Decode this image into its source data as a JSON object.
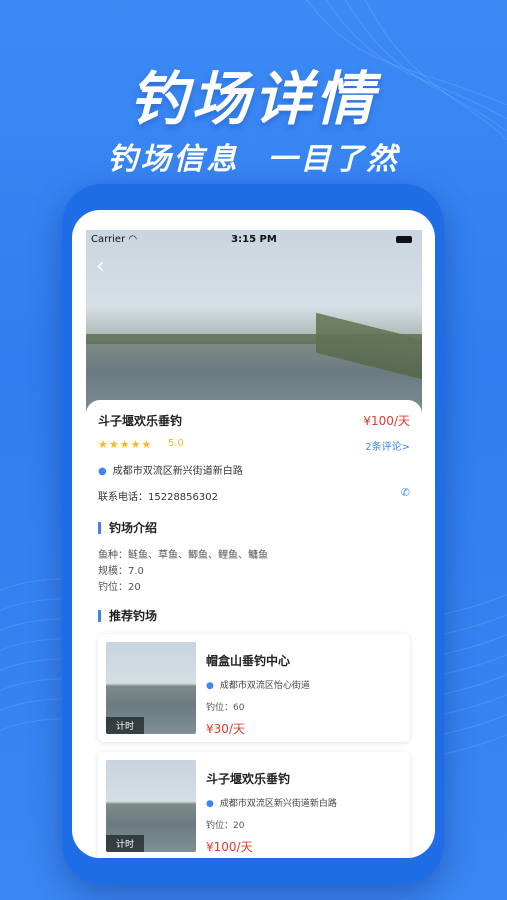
{
  "promo": {
    "headline": "钓场详情",
    "subline_left": "钓场信息",
    "subline_right": "一目了然"
  },
  "status_bar": {
    "carrier": "Carrier",
    "time": "3:15 PM"
  },
  "spot": {
    "name": "斗子堰欢乐垂钓",
    "price": "¥100/天",
    "stars": "★★★★★",
    "rating": "5.0",
    "comments_link": "2条评论>",
    "address": "成都市双流区新兴街道新白路",
    "phone_label": "联系电话：",
    "phone": "15228856302"
  },
  "intro": {
    "title": "钓场介绍",
    "fish": "鱼种：鲢鱼、草鱼、鲫鱼、鲤鱼、鳙鱼",
    "scale": "规模：7.0",
    "seats": "钓位：20"
  },
  "recommend": {
    "title": "推荐钓场",
    "items": [
      {
        "name": "帽盒山垂钓中心",
        "address": "成都市双流区怡心街道",
        "seats": "钓位：60",
        "price": "¥30/天",
        "tag": "计时"
      },
      {
        "name": "斗子堰欢乐垂钓",
        "address": "成都市双流区新兴街道新白路",
        "seats": "钓位：20",
        "price": "¥100/天",
        "tag": "计时"
      }
    ]
  },
  "colors": {
    "accent": "#3b86f0",
    "price": "#e23a2e",
    "star": "#f6b925",
    "background": "#2f7df0"
  },
  "icons": [
    "back-chevron-icon",
    "wifi-icon",
    "battery-icon",
    "location-pin-icon",
    "phone-icon",
    "star-icon"
  ]
}
